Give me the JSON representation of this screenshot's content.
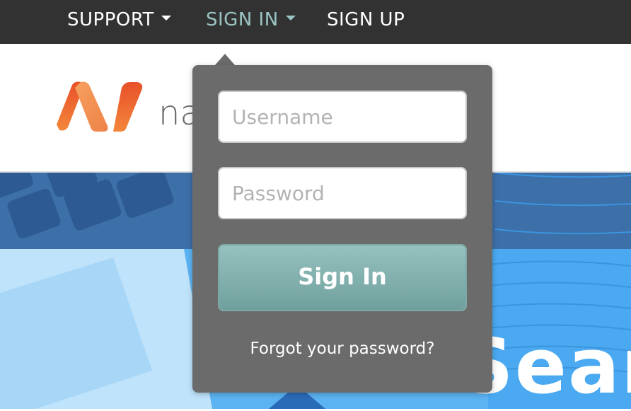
{
  "nav": {
    "items": [
      {
        "label": "SUPPORT",
        "has_caret": true
      },
      {
        "label": "SIGN IN",
        "has_caret": true,
        "active": true
      },
      {
        "label": "SIGN UP",
        "has_caret": false
      }
    ]
  },
  "header": {
    "logo_icon": "brand-n-logo",
    "logo_text_partial": "na"
  },
  "hero": {
    "headline_partial": "Sear"
  },
  "signin_dropdown": {
    "username_placeholder": "Username",
    "password_placeholder": "Password",
    "submit_label": "Sign In",
    "forgot_link": "Forgot your password?"
  },
  "colors": {
    "nav_bg": "#323232",
    "nav_active": "#9bc5c4",
    "dropdown_bg": "#6b6b6c",
    "button_bg": "#80afad",
    "brand_orange": "#f07b2e"
  }
}
